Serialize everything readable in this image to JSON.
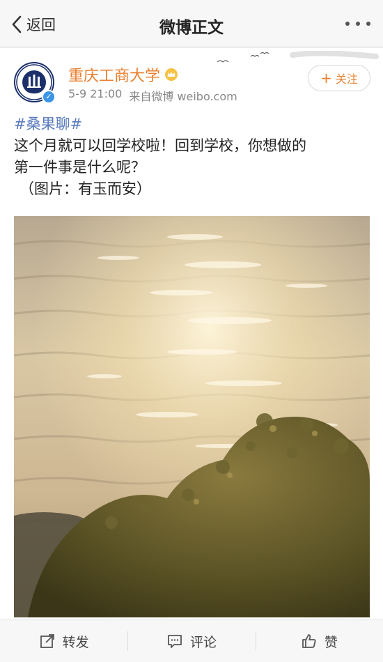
{
  "nav": {
    "back_label": "返回",
    "title": "微博正文"
  },
  "author": {
    "name": "重庆工商大学",
    "time": "5-9 21:00",
    "source": "来自微博 weibo.com",
    "verified": "✓"
  },
  "follow": {
    "plus": "+",
    "label": "关注"
  },
  "post": {
    "hashtag": "#桑果聊#",
    "line1": "这个月就可以回学校啦！回到学校，你想做的",
    "line2": "第一件事是什么呢？",
    "line3": "（图片：有玉而安）"
  },
  "actions": {
    "repost": "转发",
    "comment": "评论",
    "like": "赞"
  },
  "colors": {
    "name": "#ea7f2f",
    "hashtag": "#5b7bbd",
    "verified_badge": "#3a95e6"
  }
}
